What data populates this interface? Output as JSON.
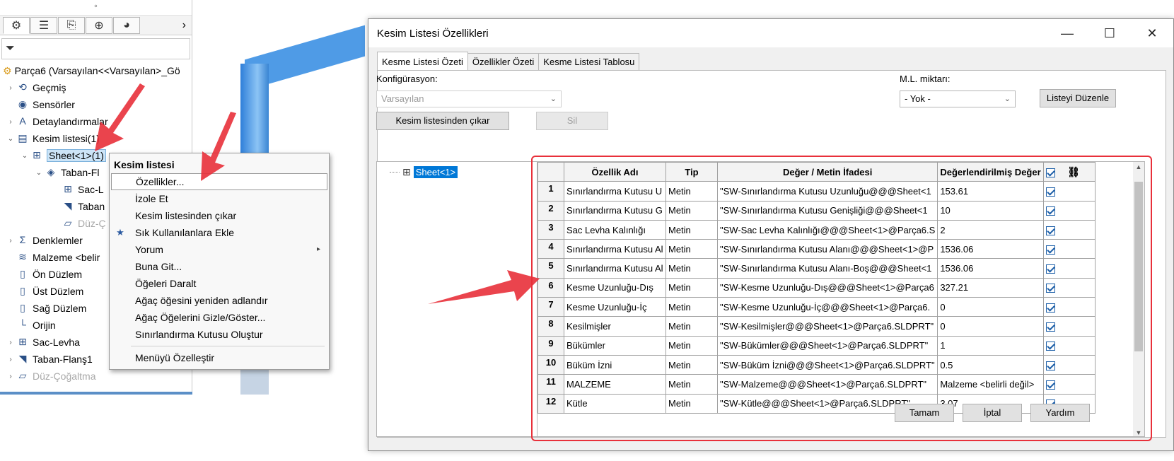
{
  "left_panel": {
    "root": "Parça6  (Varsayılan<<Varsayılan>_Gö",
    "items": [
      {
        "label": "Geçmiş",
        "exp": "›",
        "icon": "history-icon",
        "glyph": "⟲"
      },
      {
        "label": "Sensörler",
        "exp": "",
        "icon": "sensor-icon",
        "glyph": "◉"
      },
      {
        "label": "Detaylandırmalar",
        "exp": "›",
        "icon": "annotation-icon",
        "glyph": "A"
      },
      {
        "label": "Kesim listesi(1)",
        "exp": "⌄",
        "icon": "cutlist-icon",
        "glyph": "▤"
      },
      {
        "label": "Sheet<1>(1)",
        "exp": "⌄",
        "icon": "sheet-icon",
        "glyph": "⊞"
      },
      {
        "label": "Taban-Fl",
        "exp": "⌄",
        "icon": "flange-icon",
        "glyph": "◈"
      },
      {
        "label": "Sac-L",
        "exp": "",
        "icon": "sheetmetal-icon",
        "glyph": "⊞"
      },
      {
        "label": "Taban",
        "exp": "",
        "icon": "base-flange-icon",
        "glyph": "◥"
      },
      {
        "label": "Düz-Ç",
        "exp": "",
        "icon": "flat-pattern-icon",
        "glyph": "▱"
      },
      {
        "label": "Denklemler",
        "exp": "›",
        "icon": "equation-icon",
        "glyph": "Σ"
      },
      {
        "label": "Malzeme <belir",
        "exp": "",
        "icon": "material-icon",
        "glyph": "≋"
      },
      {
        "label": "Ön Düzlem",
        "exp": "",
        "icon": "plane-icon",
        "glyph": "▯"
      },
      {
        "label": "Üst Düzlem",
        "exp": "",
        "icon": "plane-icon",
        "glyph": "▯"
      },
      {
        "label": "Sağ Düzlem",
        "exp": "",
        "icon": "plane-icon",
        "glyph": "▯"
      },
      {
        "label": "Orijin",
        "exp": "",
        "icon": "origin-icon",
        "glyph": "└"
      },
      {
        "label": "Sac-Levha",
        "exp": "›",
        "icon": "sheetmetal-icon",
        "glyph": "⊞"
      },
      {
        "label": "Taban-Flanş1",
        "exp": "›",
        "icon": "base-flange-icon",
        "glyph": "◥"
      },
      {
        "label": "Düz-Çoğaltma",
        "exp": "›",
        "icon": "flat-pattern-icon",
        "glyph": "▱"
      }
    ]
  },
  "context_menu": {
    "header": "Kesim listesi",
    "items": [
      {
        "label": "Özellikler...",
        "icon": "",
        "sub": ""
      },
      {
        "label": "İzole Et",
        "icon": "",
        "sub": ""
      },
      {
        "label": "Kesim listesinden çıkar",
        "icon": "",
        "sub": ""
      },
      {
        "label": "Sık Kullanılanlara Ekle",
        "icon": "★",
        "sub": ""
      },
      {
        "label": "Yorum",
        "icon": "",
        "sub": "▸"
      },
      {
        "label": "Buna Git...",
        "icon": "",
        "sub": ""
      },
      {
        "label": "Öğeleri Daralt",
        "icon": "",
        "sub": ""
      },
      {
        "label": "Ağaç öğesini yeniden adlandır",
        "icon": "",
        "sub": ""
      },
      {
        "label": "Ağaç Öğelerini Gizle/Göster...",
        "icon": "",
        "sub": ""
      },
      {
        "label": "Sınırlandırma Kutusu Oluştur",
        "icon": "",
        "sub": ""
      },
      {
        "label": "Menüyü Özelleştir",
        "icon": "",
        "sub": ""
      }
    ]
  },
  "dialog": {
    "title": "Kesim Listesi Özellikleri",
    "tabs": [
      "Kesme Listesi Özeti",
      "Özellikler Özeti",
      "Kesme Listesi Tablosu"
    ],
    "config_label": "Konfigürasyon:",
    "config_value": "Varsayılan",
    "ml_label": "M.L. miktarı:",
    "ml_value": "- Yok -",
    "edit_list_button": "Listeyi Düzenle",
    "remove_button": "Kesim listesinden çıkar",
    "delete_button": "Sil",
    "tree_item": "Sheet<1>",
    "columns": [
      "Özellik Adı",
      "Tip",
      "Değer / Metin İfadesi",
      "Değerlendirilmiş Değer"
    ],
    "rows": [
      {
        "n": "1",
        "name": "Sınırlandırma Kutusu U",
        "type": "Metin",
        "expr": "\"SW-Sınırlandırma Kutusu Uzunluğu@@@Sheet<1",
        "val": "153.61"
      },
      {
        "n": "2",
        "name": "Sınırlandırma Kutusu G",
        "type": "Metin",
        "expr": "\"SW-Sınırlandırma Kutusu Genişliği@@@Sheet<1",
        "val": "10"
      },
      {
        "n": "3",
        "name": "Sac Levha Kalınlığı",
        "type": "Metin",
        "expr": "\"SW-Sac Levha Kalınlığı@@@Sheet<1>@Parça6.S",
        "val": "2"
      },
      {
        "n": "4",
        "name": "Sınırlandırma Kutusu Al",
        "type": "Metin",
        "expr": "\"SW-Sınırlandırma Kutusu Alanı@@@Sheet<1>@P",
        "val": "1536.06"
      },
      {
        "n": "5",
        "name": "Sınırlandırma Kutusu Al",
        "type": "Metin",
        "expr": "\"SW-Sınırlandırma Kutusu Alanı-Boş@@@Sheet<1",
        "val": "1536.06"
      },
      {
        "n": "6",
        "name": "Kesme Uzunluğu-Dış",
        "type": "Metin",
        "expr": "\"SW-Kesme Uzunluğu-Dış@@@Sheet<1>@Parça6",
        "val": "327.21"
      },
      {
        "n": "7",
        "name": "Kesme Uzunluğu-İç",
        "type": "Metin",
        "expr": "\"SW-Kesme Uzunluğu-İç@@@Sheet<1>@Parça6.",
        "val": "0"
      },
      {
        "n": "8",
        "name": "Kesilmişler",
        "type": "Metin",
        "expr": "\"SW-Kesilmişler@@@Sheet<1>@Parça6.SLDPRT\"",
        "val": "0"
      },
      {
        "n": "9",
        "name": "Bükümler",
        "type": "Metin",
        "expr": "\"SW-Bükümler@@@Sheet<1>@Parça6.SLDPRT\"",
        "val": "1"
      },
      {
        "n": "10",
        "name": "Büküm İzni",
        "type": "Metin",
        "expr": "\"SW-Büküm İzni@@@Sheet<1>@Parça6.SLDPRT\"",
        "val": "0.5"
      },
      {
        "n": "11",
        "name": "MALZEME",
        "type": "Metin",
        "expr": "\"SW-Malzeme@@@Sheet<1>@Parça6.SLDPRT\"",
        "val": "Malzeme <belirli değil>"
      },
      {
        "n": "12",
        "name": "Kütle",
        "type": "Metin",
        "expr": "\"SW-Kütle@@@Sheet<1>@Parça6.SLDPRT\"",
        "val": "3.07"
      }
    ],
    "ok_button": "Tamam",
    "cancel_button": "İptal",
    "help_button": "Yardım"
  }
}
